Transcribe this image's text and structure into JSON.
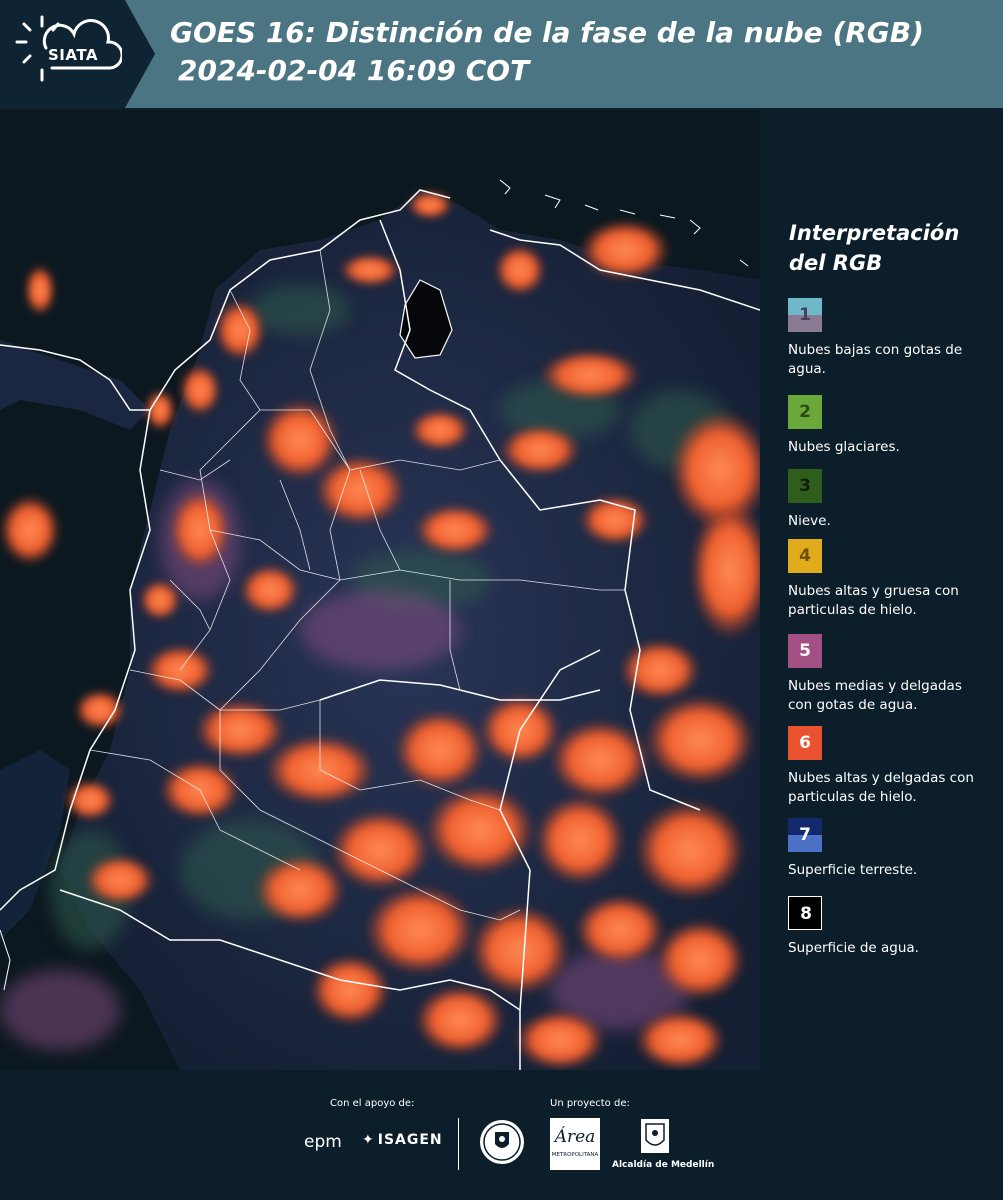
{
  "header": {
    "logo_text": "SIATA",
    "title_line1": "GOES 16: Distinción de la fase de la nube (RGB)",
    "title_line2": "2024-02-04 16:09 COT"
  },
  "legend": {
    "title": "Interpretación del RGB",
    "items": [
      {
        "number": "1",
        "label": "Nubes bajas con gotas de agua.",
        "color_top": "#6fb8c7",
        "color_bottom": "#8a7a94",
        "number_color": "#4a3f55"
      },
      {
        "number": "2",
        "label": "Nubes glaciares.",
        "color_top": "#6aa839",
        "color_bottom": "#6aa839",
        "number_color": "#2b4a17"
      },
      {
        "number": "3",
        "label": "Nieve.",
        "color_top": "#2f5e1c",
        "color_bottom": "#2f5e1c",
        "number_color": "#0f1f08"
      },
      {
        "number": "4",
        "label": "Nubes altas y gruesa con particulas de hielo.",
        "color_top": "#e0ac1c",
        "color_bottom": "#e0ac1c",
        "number_color": "#6b4f05"
      },
      {
        "number": "5",
        "label": "Nubes medias y delgadas con gotas de agua.",
        "color_top": "#a24f83",
        "color_bottom": "#a24f83",
        "number_color": "#ffffff"
      },
      {
        "number": "6",
        "label": "Nubes altas y delgadas con particulas de hielo.",
        "color_top": "#e8522e",
        "color_bottom": "#e8522e",
        "number_color": "#ffffff"
      },
      {
        "number": "7",
        "label": "Superficie terreste.",
        "color_top": "#14296b",
        "color_bottom": "#4b72c4",
        "number_color": "#ffffff"
      },
      {
        "number": "8",
        "label": "Superficie de agua.",
        "color_top": "#000000",
        "color_bottom": "#000000",
        "number_color": "#ffffff"
      }
    ]
  },
  "footer": {
    "support_label": "Con el apoyo de:",
    "project_label": "Un proyecto de:",
    "epm_text": "epm",
    "isagen_text": "ISAGEN",
    "area_text": "Área",
    "area_subtext": "METROPOLITANA",
    "alcaldia_text": "Alcaldía de Medellín"
  },
  "colors": {
    "header_bg": "#4c7584",
    "panel_bg": "#0b1e2a",
    "cloud_orange": "#f26a3a",
    "land_dark": "#1a2a4a",
    "ocean": "#0c1a24"
  }
}
